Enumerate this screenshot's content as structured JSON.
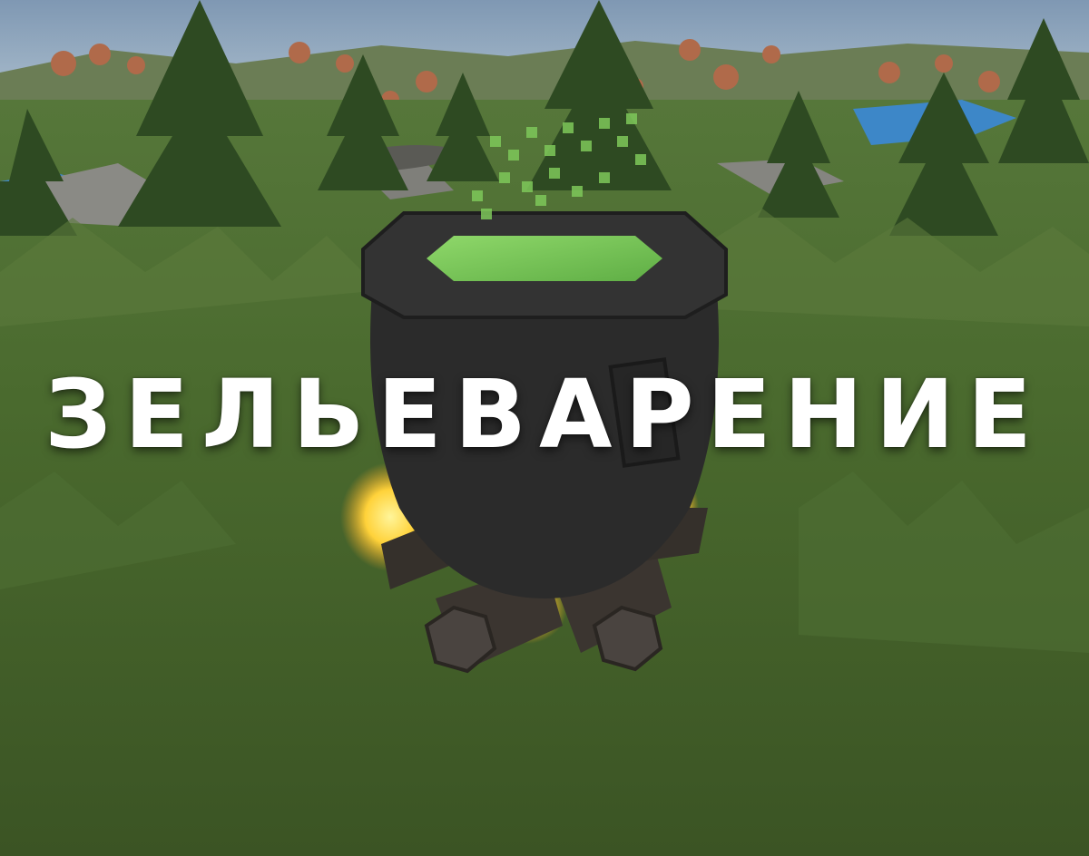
{
  "title": "ЗЕЛЬЕВАРЕНИЕ",
  "scene": {
    "subject": "cauldron-over-campfire",
    "colors": {
      "sky": "#8fa6bd",
      "grass": "#4a6a2c",
      "grass_dark": "#3a5422",
      "pine": "#2e4a22",
      "autumn_tree": "#b06a4a",
      "water": "#3d87c8",
      "cauldron": "#2b2b2b",
      "potion": "#7ec85a",
      "fire": "#ffd23a",
      "log": "#3b3530"
    }
  }
}
